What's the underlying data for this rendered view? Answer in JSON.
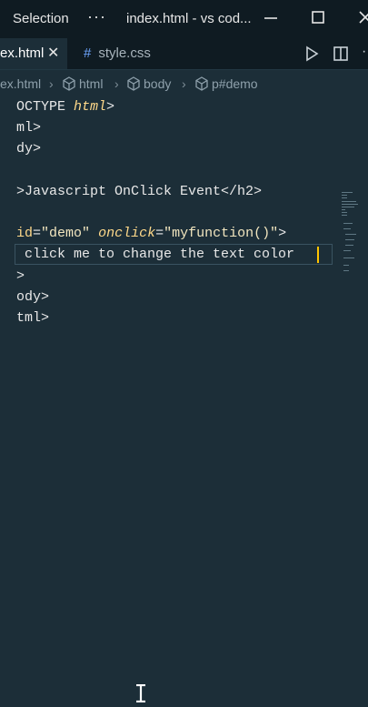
{
  "titlebar": {
    "menu_label": "Selection",
    "more": "···",
    "window_title": "index.html - vs cod..."
  },
  "tabs": [
    {
      "label": "ex.html",
      "close": "✕",
      "active": true
    },
    {
      "icon": "#",
      "label": "style.css",
      "active": false
    }
  ],
  "breadcrumb": [
    {
      "label": "ex.html"
    },
    {
      "label": "html"
    },
    {
      "label": "body"
    },
    {
      "label": "p#demo"
    }
  ],
  "code": {
    "l1_a": "OCTYPE ",
    "l1_b": "html",
    "l1_c": ">",
    "l2": "ml>",
    "l3": "dy>",
    "l4": ">Javascript OnClick Event</h2>",
    "l5_a": "id",
    "l5_b": "=",
    "l5_c": "\"demo\"",
    "l5_d": " ",
    "l5_e": "onclick",
    "l5_f": "=",
    "l5_g": "\"myfunction()\"",
    "l5_h": ">",
    "l6": " click me to change the text color",
    "l7": ">",
    "l8": "ody>",
    "l9": "tml>"
  },
  "colors": {
    "editor_bg": "#1c2e38",
    "titlebar_bg": "#0f1b22",
    "cursor": "#ffc400",
    "attribute": "#ffd98a"
  }
}
